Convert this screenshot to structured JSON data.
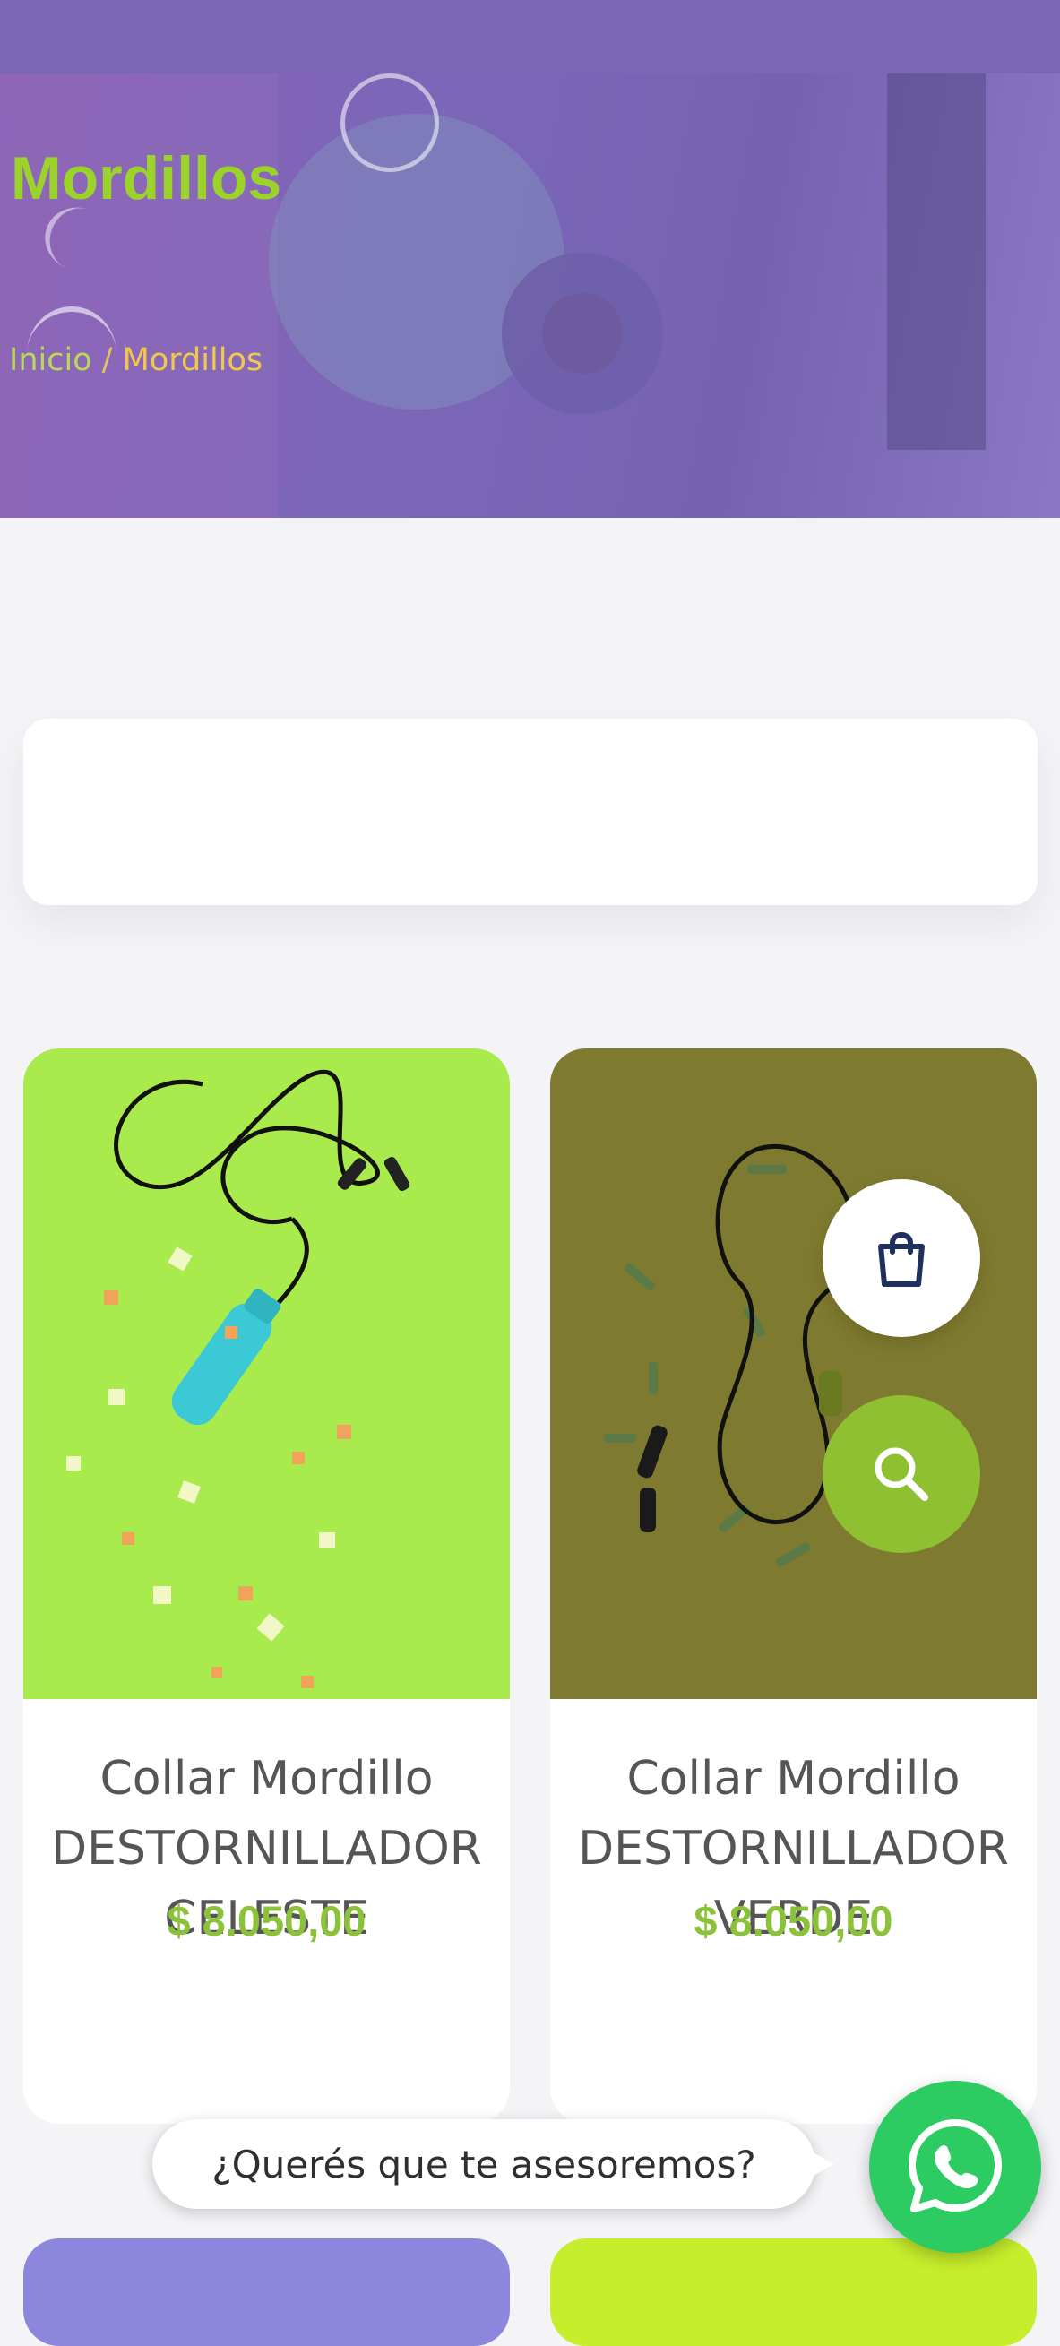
{
  "hero": {
    "title": "Mordillos",
    "breadcrumb": {
      "home": "Inicio",
      "separator": " / ",
      "current": "Mordillos"
    }
  },
  "search_panel": {
    "placeholder": ""
  },
  "products": [
    {
      "name_lines": [
        "Collar Mordillo",
        "DESTORNILLADOR",
        "CELESTE"
      ],
      "price": "$ 8.050,00",
      "image_bg": "#a9ea4c"
    },
    {
      "name_lines": [
        "Collar Mordillo",
        "DESTORNILLADOR",
        "VERDE"
      ],
      "price": "$ 8.050,00",
      "image_bg": "#7e7a2f"
    }
  ],
  "actions": {
    "cart_icon": "shopping-bag-icon",
    "search_icon": "search-icon"
  },
  "whatsapp": {
    "bubble_text": "¿Querés que te asesoremos?",
    "icon": "whatsapp-icon"
  },
  "colors": {
    "header": "#7b65b5",
    "accent_green": "#9bd22c",
    "price_green": "#8cc23a",
    "breadcrumb_yellow": "#f2c84b",
    "whatsapp_green": "#2ccc63",
    "cart_icon_navy": "#1f2f5e"
  }
}
